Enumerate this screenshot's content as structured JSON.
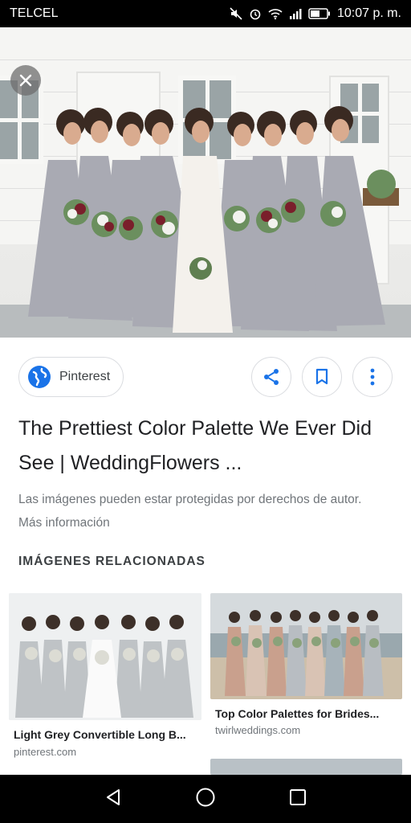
{
  "status_bar": {
    "carrier": "TELCEL",
    "time": "10:07 p. m.",
    "icons": [
      "mute-icon",
      "alarm-icon",
      "wifi-icon",
      "signal-icon",
      "battery-icon"
    ]
  },
  "hero": {
    "close_icon": "close-icon"
  },
  "source": {
    "label": "Pinterest",
    "icon": "globe-icon"
  },
  "actions": [
    "share-icon",
    "bookmark-icon",
    "more-vert-icon"
  ],
  "title": "The Prettiest Color Palette We Ever Did See | WeddingFlowers ...",
  "notice": "Las imágenes pueden estar protegidas por derechos de autor. Más información",
  "related": {
    "heading": "IMÁGENES RELACIONADAS",
    "items": [
      {
        "title": "Light Grey Convertible Long B...",
        "source": "pinterest.com"
      },
      {
        "title": "Top Color Palettes for Brides...",
        "source": "twirlweddings.com"
      }
    ]
  },
  "nav": [
    "back-icon",
    "home-icon",
    "recents-icon"
  ],
  "colors": {
    "accent": "#1a73e8",
    "dress_grey": "#a9aab3",
    "status_bg": "#000000"
  }
}
